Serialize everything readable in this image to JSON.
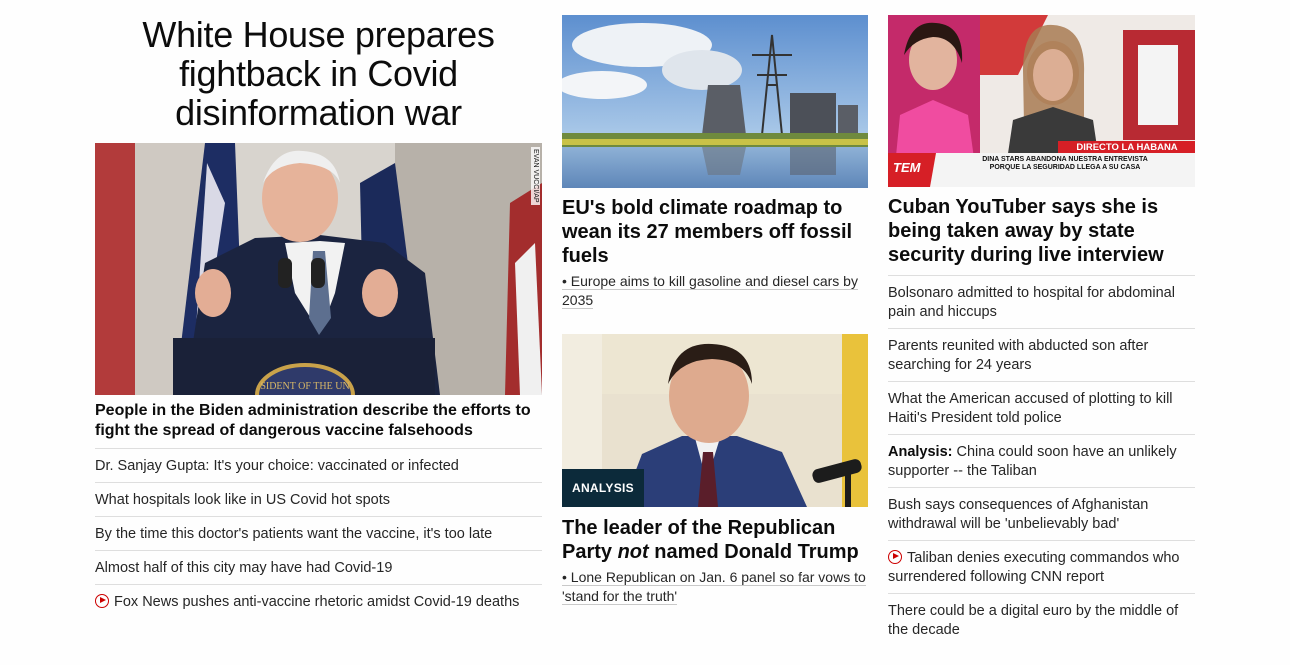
{
  "lead": {
    "headline": "White House prepares fightback in Covid disinformation war",
    "image_credit": "EVAN VUCCI/AP",
    "description": "People in the Biden administration describe the efforts to fight the spread of dangerous vaccine falsehoods",
    "links": [
      {
        "text": "Dr. Sanjay Gupta: It's your choice: vaccinated or infected",
        "video": false
      },
      {
        "text": "What hospitals look like in US Covid hot spots",
        "video": false
      },
      {
        "text": "By the time this doctor's patients want the vaccine, it's too late",
        "video": false
      },
      {
        "text": "Almost half of this city may have had Covid-19",
        "video": false
      },
      {
        "text": "Fox News pushes anti-vaccine rhetoric amidst Covid-19 deaths",
        "video": true
      }
    ]
  },
  "middle": {
    "story1": {
      "headline": "EU's bold climate roadmap to wean its 27 members off fossil fuels",
      "sub": "• Europe aims to kill gasoline and diesel cars by 2035"
    },
    "story2": {
      "badge": "ANALYSIS",
      "headline_part1": "The leader of the Republican Party ",
      "headline_em": "not",
      "headline_part2": " named Donald Trump",
      "sub": "• Lone Republican on Jan. 6 panel so far vows to 'stand for the truth'"
    }
  },
  "right": {
    "story": {
      "headline": "Cuban YouTuber says she is being taken away by state security during live interview",
      "tv_banner": "DIRECTO LA HABANA",
      "tv_logo": "TEM",
      "tv_caption": "DINA STARS ABANDONA NUESTRA ENTREVISTA PORQUE LA SEGURIDAD LLEGA A SU CASA"
    },
    "links": [
      {
        "kicker": "",
        "text": "Bolsonaro admitted to hospital for abdominal pain and hiccups",
        "video": false
      },
      {
        "kicker": "",
        "text": "Parents reunited with abducted son after searching for 24 years",
        "video": false
      },
      {
        "kicker": "",
        "text": "What the American accused of plotting to kill Haiti's President told police",
        "video": false
      },
      {
        "kicker": "Analysis:",
        "text": " China could soon have an unlikely supporter -- the Taliban",
        "video": false
      },
      {
        "kicker": "",
        "text": "Bush says consequences of Afghanistan withdrawal will be 'unbelievably bad'",
        "video": false
      },
      {
        "kicker": "",
        "text": "Taliban denies executing commandos who surrendered following CNN report",
        "video": true
      },
      {
        "kicker": "",
        "text": "There could be a digital euro by the middle of the decade",
        "video": false
      }
    ]
  },
  "colors": {
    "video_red": "#cc0000",
    "analysis_bg": "#0c2a3a",
    "divider": "#dedede"
  }
}
